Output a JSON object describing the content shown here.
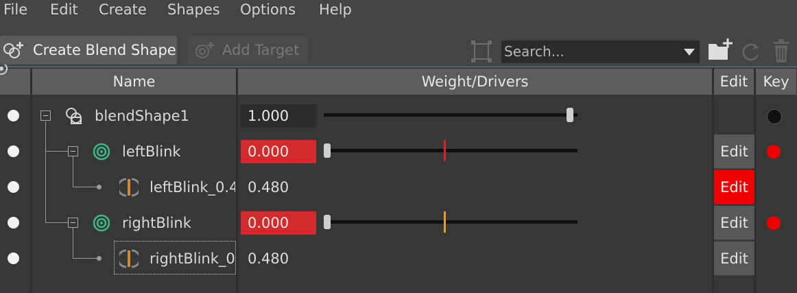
{
  "menu": [
    "File",
    "Edit",
    "Create",
    "Shapes",
    "Options",
    "Help"
  ],
  "toolbar": {
    "create_blend_shape_label": "Create Blend Shape",
    "add_target_label": "Add Target",
    "search_placeholder": "Search..."
  },
  "table": {
    "headers": {
      "name": "Name",
      "weight": "Weight/Drivers",
      "edit": "Edit",
      "key": "Key"
    },
    "rows": [
      {
        "name": "blendShape1",
        "weight": "1.000",
        "slider_level": 1.0,
        "key_state": "unkeyed"
      },
      {
        "name": "leftBlink",
        "weight": "0.000",
        "slider_level": 0.0,
        "edit": "Edit",
        "key_state": "keyed"
      },
      {
        "name": "leftBlink_0.4",
        "weight": "0.480",
        "edit": "Edit",
        "edit_active": true
      },
      {
        "name": "rightBlink",
        "weight": "0.000",
        "slider_level": 0.0,
        "edit": "Edit",
        "key_state": "keyed"
      },
      {
        "name": "rightBlink_0",
        "weight": "0.480",
        "edit": "Edit"
      }
    ]
  },
  "colors": {
    "keyed_field": "#d22b2b",
    "key_dot": "#ee0000",
    "target_icon": "#3fb88a",
    "inbetween_icon": "#d08a3a",
    "left_blink_tick": "#e02020",
    "right_blink_tick": "#e0a020"
  }
}
